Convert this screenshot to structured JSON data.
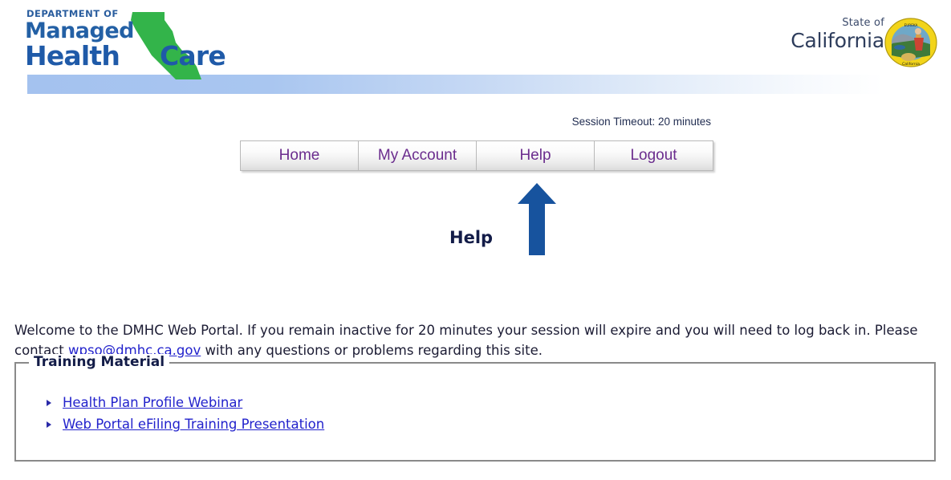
{
  "header": {
    "logo": {
      "line1": "DEPARTMENT OF",
      "line2": "Managed",
      "line3": "Health",
      "line4": "Care",
      "shape_name": "california-state-outline",
      "color_blue": "#1f5aa8",
      "color_green": "#33b44a"
    },
    "state": {
      "line1": "State of",
      "line2": "California",
      "seal_name": "california-great-seal"
    }
  },
  "session": {
    "timeout_text": "Session Timeout: 20 minutes"
  },
  "nav": {
    "tabs": [
      {
        "label": "Home"
      },
      {
        "label": "My Account"
      },
      {
        "label": "Help"
      },
      {
        "label": "Logout"
      }
    ],
    "active_tab": "Help",
    "link_color": "#6b2d8e"
  },
  "callout": {
    "label": "Help",
    "arrow_direction": "up",
    "arrow_color": "#17539e"
  },
  "welcome": {
    "part1": "Welcome to the DMHC Web Portal. If you remain inactive for 20 minutes your session will expire and you will need to log back in. Please contact ",
    "email": "wpso@dmhc.ca.gov",
    "part2": " with any questions or problems regarding this site."
  },
  "training": {
    "legend": "Training Material",
    "links": [
      {
        "label": "Health Plan Profile Webinar"
      },
      {
        "label": "Web Portal eFiling Training Presentation"
      }
    ]
  }
}
